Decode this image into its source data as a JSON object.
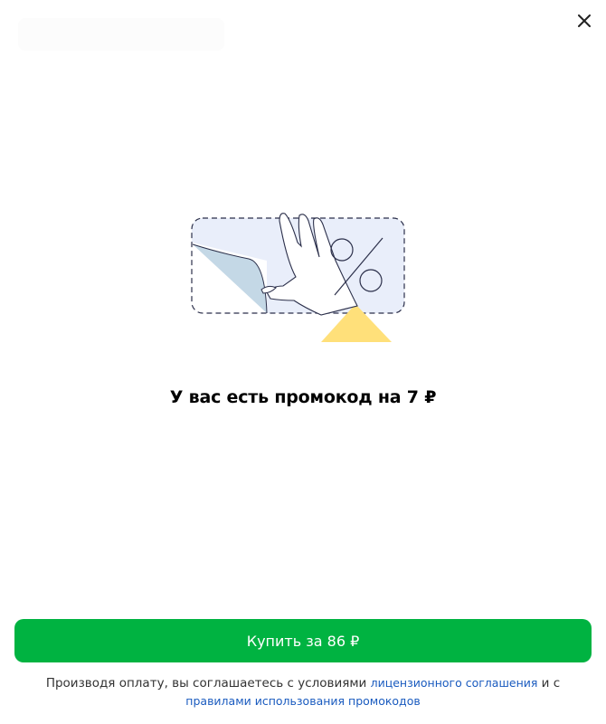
{
  "dialog": {
    "close_icon": "close-icon",
    "illustration": "promo-coupon-illustration",
    "title": "У вас есть промокод на 7 ₽",
    "buy_button_label": "Купить за 86 ₽",
    "legal": {
      "text_before": "Производя оплату, вы соглашаетесь с условиями ",
      "license_link": "лицензионного соглашения",
      "text_middle": " и с ",
      "rules_link": "правилами использования промокодов"
    }
  },
  "colors": {
    "primary_button": "#00b341",
    "link": "#1a5bbf",
    "coupon_fill": "#e9eefa",
    "peel_fill": "#c4d8e6",
    "triangle": "#ffe07a"
  }
}
